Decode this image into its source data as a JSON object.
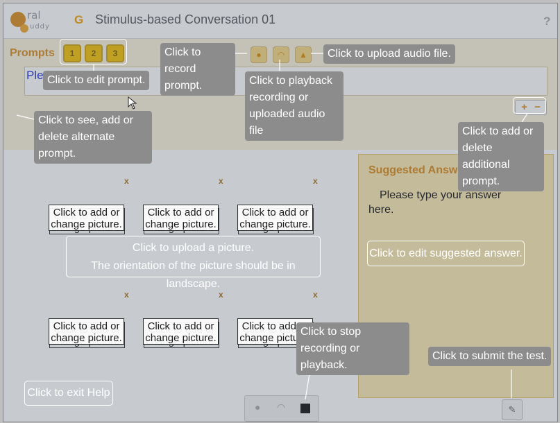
{
  "app": {
    "logo_top": "ral",
    "logo_bottom": "uddy",
    "title": "Stimulus-based Conversation 01",
    "help": "?",
    "g_icon": "G"
  },
  "prompts": {
    "label": "Prompts",
    "buttons": [
      "1",
      "2",
      "3"
    ],
    "text": "Ple... n pr..."
  },
  "prompt_controls": {
    "plus": "+",
    "minus": "−"
  },
  "pictures": {
    "remove": "x",
    "slot_label": "Click to add or change picture."
  },
  "answer": {
    "title": "Suggested Answer",
    "text": "Please type your answer here."
  },
  "help": {
    "edit_prompt": "Click to edit prompt.",
    "record": "Click to record prompt.",
    "upload_audio": "Click to upload audio file.",
    "playback": "Click to playback recording or uploaded audio file",
    "alternate": "Click to see, add or delete alternate prompt.",
    "additional": "Click to add or delete additional prompt.",
    "upload_picture_1": "Click to upload a picture.",
    "upload_picture_2": "The orientation of the picture should be in landscape.",
    "edit_answer": "Click to edit suggested answer.",
    "stop": "Click to stop recording or playback.",
    "submit": "Click to submit the test.",
    "exit": "Click to exit Help"
  },
  "colors": {
    "accent": "#d98a18",
    "prompt_button": "#f3c000",
    "tooltip": "#8c8c8c"
  },
  "icons": [
    "mic-icon",
    "headphones-icon",
    "upload-arrow-icon",
    "stop-icon",
    "submit-icon",
    "help-icon"
  ]
}
